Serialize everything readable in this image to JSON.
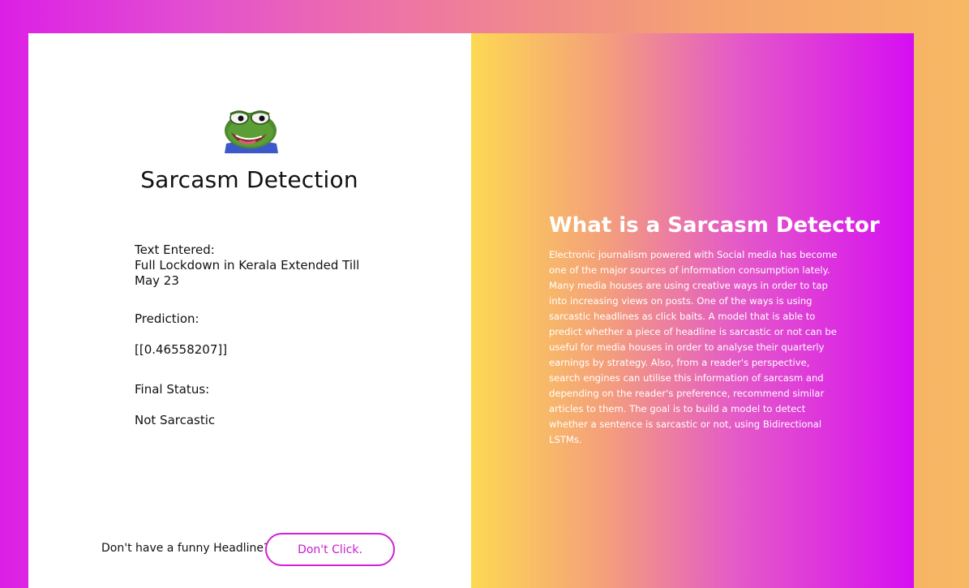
{
  "left": {
    "logo": "pepe-frog-logo",
    "title": "Sarcasm Detection",
    "text_label": "Text Entered:",
    "text_value": "Full Lockdown in Kerala Extended Till May 23",
    "prediction_label": "Prediction:",
    "prediction_value": "[[0.46558207]]",
    "final_label": "Final Status:",
    "final_value": "Not Sarcastic",
    "footer_prompt": "Don't have a funny Headline?",
    "button_label": "Don't Click."
  },
  "right": {
    "title": "What is a Sarcasm Detector",
    "description": "Electronic journalism powered with Social media has become one of the major sources of information consumption lately. Many media houses are using creative ways in order to tap into increasing views on posts. One of the ways is using sarcastic headlines as click baits. A model that is able to predict whether a piece of headline is sarcastic or not can be useful for media houses in order to analyse their quarterly earnings by strategy. Also, from a reader's perspective, search engines can utilise this information of sarcasm and depending on the reader's preference, recommend similar articles to them. The goal is to build a model to detect whether a sentence is sarcastic or not, using Bidirectional LSTMs."
  },
  "colors": {
    "accent": "#d020d8",
    "background_left": "#dc1fe6",
    "background_right": "#f7b863",
    "panel_gradient_start": "#fdd853",
    "panel_gradient_end": "#d60ef2"
  }
}
